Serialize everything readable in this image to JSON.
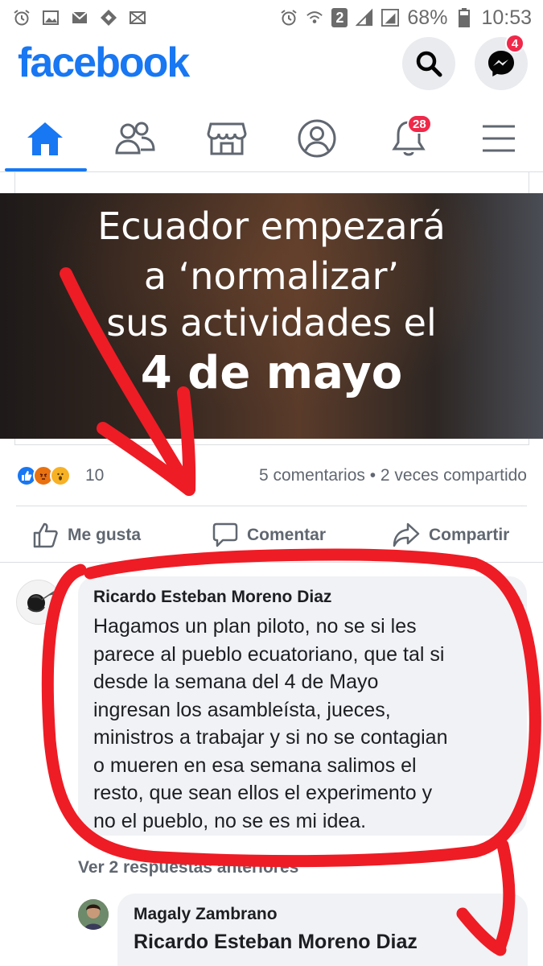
{
  "status_bar": {
    "battery": "68%",
    "time": "10:53",
    "sim_badge": "2",
    "left_icons": [
      "alarm-icon",
      "image-icon",
      "gmail-icon",
      "signal-app-icon",
      "email-icon"
    ],
    "right_icons": [
      "alarm-icon",
      "wifi-icon",
      "signal-bars-icon",
      "signal-bars-icon",
      "battery-icon"
    ]
  },
  "header": {
    "logo": "facebook",
    "messenger_badge": "4"
  },
  "nav": {
    "tabs": [
      "home-icon",
      "friends-icon",
      "marketplace-icon",
      "profile-icon",
      "notifications-icon",
      "menu-icon"
    ],
    "notifications_badge": "28"
  },
  "post": {
    "image_text": {
      "line1": "Ecuador empezará",
      "line2": "a ‘normalizar’",
      "line3": "sus actividades el",
      "line4": "4 de mayo"
    },
    "reaction_count": "10",
    "summary": "5 comentarios • 2 veces compartido",
    "actions": {
      "like": "Me gusta",
      "comment": "Comentar",
      "share": "Compartir"
    }
  },
  "comments": [
    {
      "author": "Ricardo Esteban Moreno Diaz",
      "text": "Hagamos un plan piloto, no se si les\nparece al pueblo ecuatoriano, que tal si\ndesde la semana del 4 de Mayo\ningresan los asambleísta, jueces,\nministros a trabajar y si no se contagian\no mueren en esa semana salimos el\nresto, que sean ellos el experimento y\nno el pueblo, no se es mi idea."
    }
  ],
  "replies_link": "Ver 2 respuestas anteriores",
  "reply": {
    "author": "Magaly Zambrano",
    "mention": "Ricardo Esteban Moreno Diaz"
  },
  "colors": {
    "brand": "#1877f2",
    "badge": "#f02849",
    "annotation": "#ee1c25"
  }
}
